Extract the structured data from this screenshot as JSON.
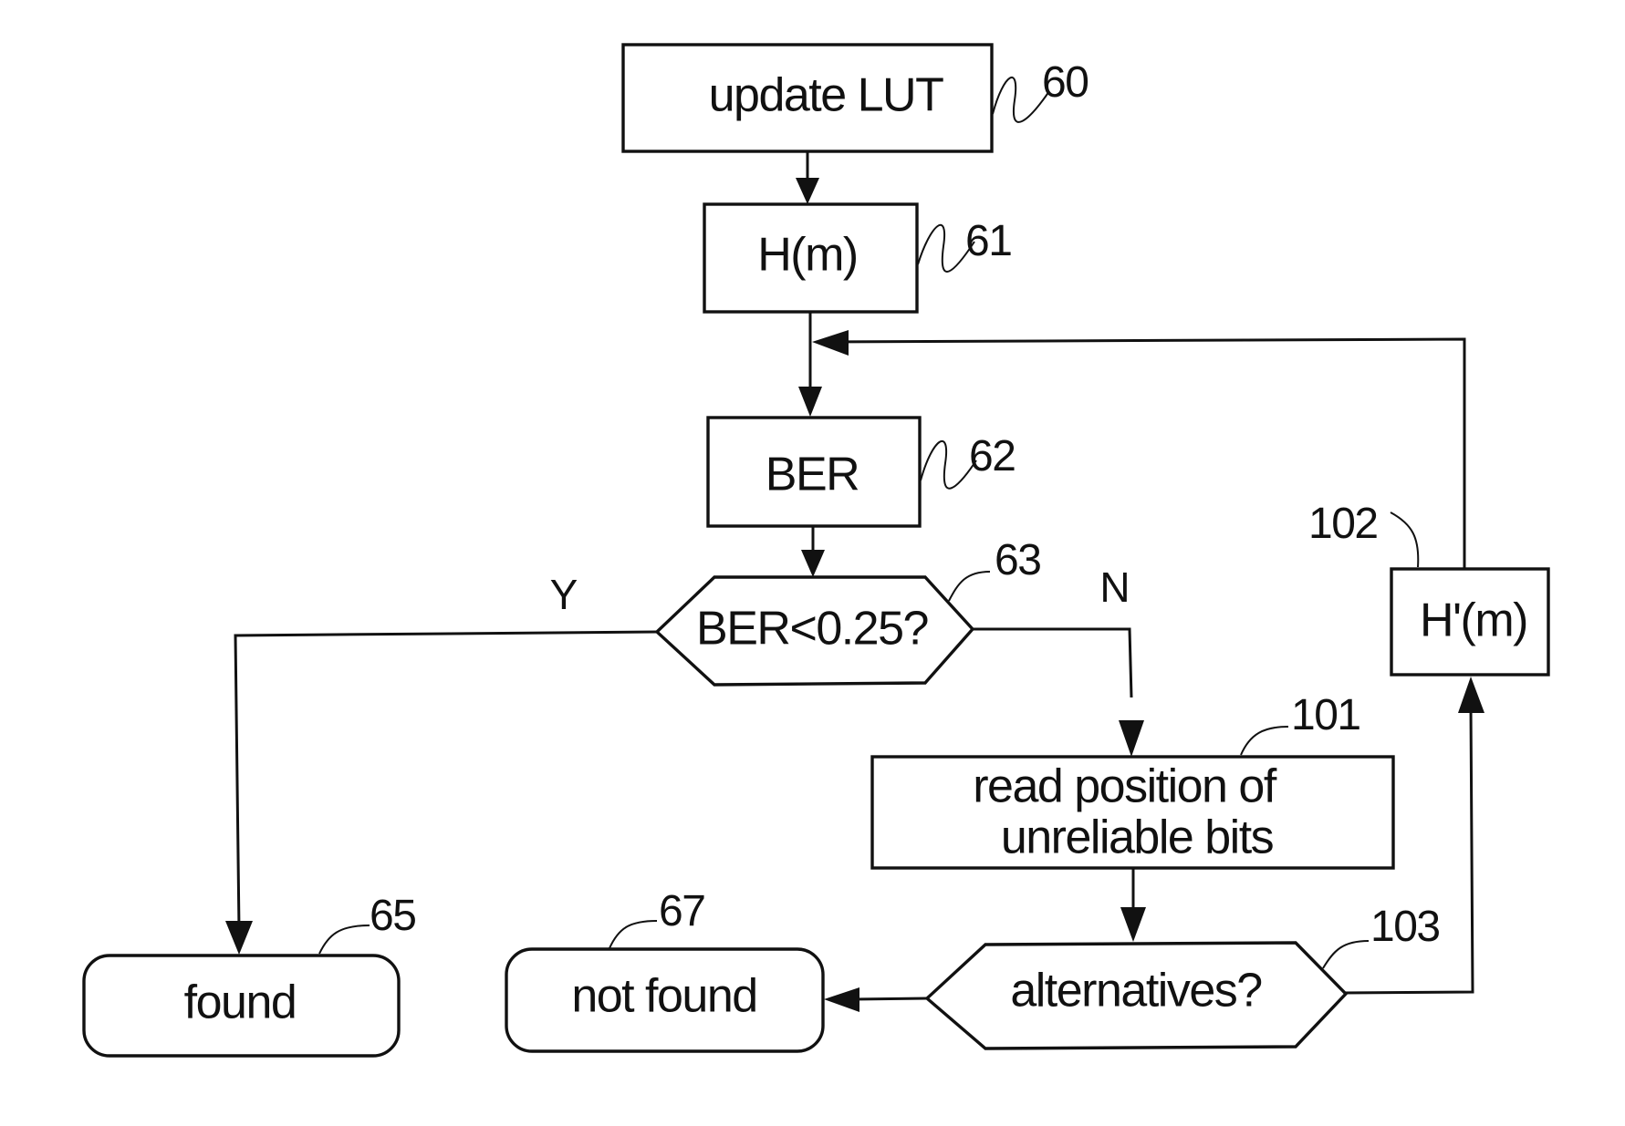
{
  "nodes": {
    "update_lut": {
      "label": "update LUT",
      "ref": "60"
    },
    "h_m": {
      "label": "H(m)",
      "ref": "61"
    },
    "ber": {
      "label": "BER",
      "ref": "62"
    },
    "ber_decision": {
      "label": "BER<0.25?",
      "ref": "63"
    },
    "found": {
      "label": "found",
      "ref": "65"
    },
    "not_found": {
      "label": "not found",
      "ref": "67"
    },
    "read_positions": {
      "label_line1": "read position of",
      "label_line2": "unreliable bits",
      "ref": "101"
    },
    "h_prime_m": {
      "label": "H'(m)",
      "ref": "102"
    },
    "alternatives": {
      "label": "alternatives?",
      "ref": "103"
    }
  },
  "branches": {
    "yes": "Y",
    "no": "N"
  },
  "edges": [
    {
      "from": "update_lut",
      "to": "h_m"
    },
    {
      "from": "h_m",
      "to": "ber"
    },
    {
      "from": "ber",
      "to": "ber_decision"
    },
    {
      "from": "ber_decision",
      "to": "found",
      "branch": "Y"
    },
    {
      "from": "ber_decision",
      "to": "read_positions",
      "branch": "N"
    },
    {
      "from": "read_positions",
      "to": "alternatives"
    },
    {
      "from": "alternatives",
      "to": "not_found"
    },
    {
      "from": "alternatives",
      "to": "h_prime_m"
    },
    {
      "from": "h_prime_m",
      "to": "ber"
    }
  ]
}
